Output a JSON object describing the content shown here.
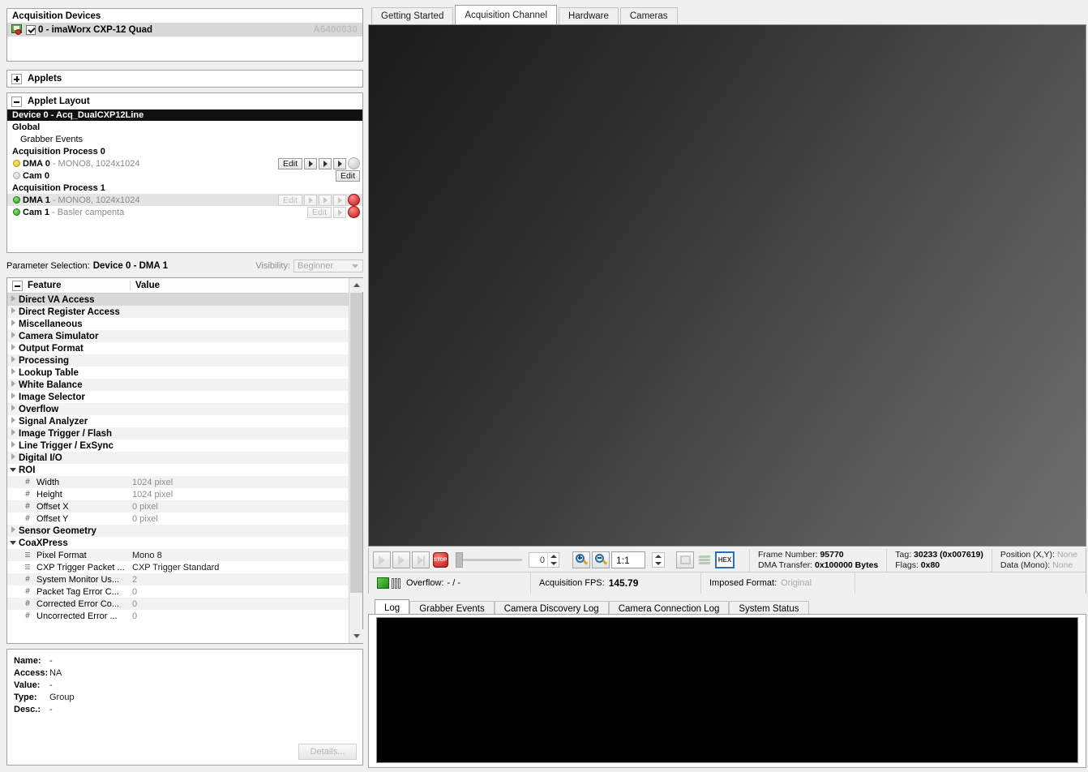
{
  "left": {
    "acquisition_devices": {
      "title": "Acquisition Devices",
      "device": {
        "label": "0 - imaWorx CXP-12 Quad",
        "serial": "A6400030",
        "checked": true,
        "icon": "device-board-icon"
      }
    },
    "applets": {
      "label": "Applets",
      "expander": "plus"
    },
    "applet_layout": {
      "label": "Applet Layout",
      "expander": "minus",
      "rows": [
        {
          "kind": "header-black",
          "text": "Device 0 - Acq_DualCXP12Line"
        },
        {
          "kind": "group",
          "text": "Global"
        },
        {
          "kind": "sub",
          "text": "Grabber Events"
        },
        {
          "kind": "group",
          "text": "Acquisition Process 0"
        },
        {
          "kind": "dma",
          "dot": "yellow",
          "name": "DMA 0",
          "desc": "- MONO8, 1024x1024",
          "buttons": {
            "edit": "Edit",
            "edit_enabled": true,
            "play": true,
            "single": true,
            "step": true,
            "stop_active": false
          }
        },
        {
          "kind": "cam",
          "dot": "gray",
          "name": "Cam 0",
          "desc": "",
          "buttons": {
            "edit": "Edit",
            "edit_enabled": true
          }
        },
        {
          "kind": "group",
          "text": "Acquisition Process 1"
        },
        {
          "kind": "dma",
          "dot": "green",
          "name": "DMA 1",
          "desc": "- MONO8, 1024x1024",
          "shaded": true,
          "buttons": {
            "edit": "Edit",
            "edit_enabled": false,
            "play": false,
            "single": false,
            "step": false,
            "stop_active": true
          }
        },
        {
          "kind": "cam",
          "dot": "green",
          "name": "Cam 1",
          "desc": "- Basler campenta",
          "buttons": {
            "edit": "Edit",
            "edit_enabled": false,
            "play": false,
            "stop_active": true
          }
        }
      ]
    },
    "parameter_selection": {
      "label": "Parameter Selection:",
      "value": "Device 0 - DMA 1",
      "visibility_label": "Visibility:",
      "visibility_value": "Beginner"
    },
    "feature_tree": {
      "columns": {
        "feature": "Feature",
        "value": "Value"
      },
      "rows": [
        {
          "type": "group",
          "expanded": false,
          "name": "Direct VA Access",
          "value": "",
          "selected": true
        },
        {
          "type": "group",
          "expanded": false,
          "name": "Direct Register Access",
          "value": ""
        },
        {
          "type": "group",
          "expanded": false,
          "name": "Miscellaneous",
          "value": ""
        },
        {
          "type": "group",
          "expanded": false,
          "name": "Camera Simulator",
          "value": ""
        },
        {
          "type": "group",
          "expanded": false,
          "name": "Output Format",
          "value": ""
        },
        {
          "type": "group",
          "expanded": false,
          "name": "Processing",
          "value": ""
        },
        {
          "type": "group",
          "expanded": false,
          "name": "Lookup Table",
          "value": ""
        },
        {
          "type": "group",
          "expanded": false,
          "name": "White Balance",
          "value": ""
        },
        {
          "type": "group",
          "expanded": false,
          "name": "Image Selector",
          "value": ""
        },
        {
          "type": "group",
          "expanded": false,
          "name": "Overflow",
          "value": ""
        },
        {
          "type": "group",
          "expanded": false,
          "name": "Signal Analyzer",
          "value": ""
        },
        {
          "type": "group",
          "expanded": false,
          "name": "Image Trigger / Flash",
          "value": ""
        },
        {
          "type": "group",
          "expanded": false,
          "name": "Line Trigger / ExSync",
          "value": ""
        },
        {
          "type": "group",
          "expanded": false,
          "name": "Digital I/O",
          "value": ""
        },
        {
          "type": "group",
          "expanded": true,
          "name": "ROI",
          "value": ""
        },
        {
          "type": "leaf",
          "icon": "#",
          "name": "Width",
          "value": "1024 pixel"
        },
        {
          "type": "leaf",
          "icon": "#",
          "name": "Height",
          "value": "1024 pixel"
        },
        {
          "type": "leaf",
          "icon": "#",
          "name": "Offset X",
          "value": "0 pixel"
        },
        {
          "type": "leaf",
          "icon": "#",
          "name": "Offset Y",
          "value": "0 pixel"
        },
        {
          "type": "group",
          "expanded": false,
          "name": "Sensor Geometry",
          "value": ""
        },
        {
          "type": "group",
          "expanded": true,
          "name": "CoaXPress",
          "value": ""
        },
        {
          "type": "leaf",
          "icon": "list",
          "name": "Pixel Format",
          "value": "Mono 8",
          "dark": true
        },
        {
          "type": "leaf",
          "icon": "list",
          "name": "CXP Trigger Packet ...",
          "value": "CXP Trigger Standard",
          "dark": true
        },
        {
          "type": "leaf",
          "icon": "#",
          "name": "System Monitor Us...",
          "value": "2"
        },
        {
          "type": "leaf",
          "icon": "#",
          "name": "Packet Tag Error C...",
          "value": "0"
        },
        {
          "type": "leaf",
          "icon": "#",
          "name": "Corrected Error Co...",
          "value": "0"
        },
        {
          "type": "leaf",
          "icon": "#",
          "name": "Uncorrected Error ...",
          "value": "0"
        }
      ]
    },
    "info": {
      "fields": [
        {
          "key": "Name:",
          "value": "-"
        },
        {
          "key": "Access:",
          "value": "NA"
        },
        {
          "key": "Value:",
          "value": "-"
        },
        {
          "key": "Type:",
          "value": "Group"
        },
        {
          "key": "Desc.:",
          "value": "-"
        }
      ],
      "details_button": "Details..."
    }
  },
  "right": {
    "tabs": [
      {
        "label": "Getting Started",
        "active": false
      },
      {
        "label": "Acquisition Channel",
        "active": true
      },
      {
        "label": "Hardware",
        "active": false
      },
      {
        "label": "Cameras",
        "active": false
      }
    ],
    "control_bar": {
      "frame_slider_value": "0",
      "zoom_value": "1:1",
      "buttons": [
        "play-icon",
        "single-shot-icon",
        "step-icon",
        "stop-icon",
        "zoom-in-icon",
        "zoom-out-icon",
        "snapshot-icon",
        "layers-icon",
        "hex-icon"
      ],
      "hex_label": "HEX",
      "stats": [
        {
          "lines": [
            {
              "key": "Frame Number: ",
              "value": "95770"
            },
            {
              "key": "DMA Transfer: ",
              "value": "0x100000 Bytes"
            }
          ]
        },
        {
          "lines": [
            {
              "key": "Tag: ",
              "value": "30233 (0x007619)"
            },
            {
              "key": "Flags: ",
              "value": "0x80"
            }
          ]
        },
        {
          "lines": [
            {
              "key": "Position (X,Y): ",
              "value": "None",
              "muted": true
            },
            {
              "key": "Data (Mono): ",
              "value": "None",
              "muted": true
            }
          ]
        }
      ]
    },
    "status_bar": {
      "overflow_label": "Overflow:",
      "overflow_value": "- / -",
      "fps_label": "Acquisition FPS:",
      "fps_value": "145.79",
      "imposed_label": "Imposed Format:",
      "imposed_value": "Original"
    },
    "log_tabs": [
      {
        "label": "Log",
        "active": true
      },
      {
        "label": "Grabber Events",
        "active": false
      },
      {
        "label": "Camera Discovery Log",
        "active": false
      },
      {
        "label": "Camera Connection Log",
        "active": false
      },
      {
        "label": "System Status",
        "active": false
      }
    ]
  }
}
